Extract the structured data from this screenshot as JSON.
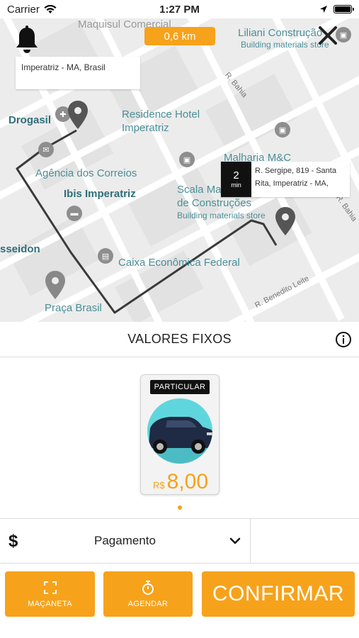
{
  "status_bar": {
    "carrier": "Carrier",
    "time": "1:27 PM"
  },
  "map": {
    "distance": "0,6 km",
    "origin_address": "Imperatriz - MA, Brasil",
    "destination": {
      "eta_value": "2",
      "eta_unit": "min",
      "address": "R. Sergipe, 819 - Santa Rita, Imperatriz - MA,"
    },
    "labels": {
      "maquisul": "Maquisul Comercial",
      "liliani": "Liliani Construção",
      "building_materials_top": "Building materials store",
      "drogasil": "Drogasil",
      "residence_hotel": "Residence Hotel Imperatriz",
      "malharia": "Malharia M&C",
      "agencia": "Agência dos Correios",
      "ibis": "Ibis Imperatriz",
      "scala": "Scala Materiais de Construções",
      "building_materials_mid": "Building materials store",
      "posseidon": "sseidon",
      "caixa": "Caixa Econômica Federal",
      "praca": "Praça Brasil",
      "rua_bahia_top": "R. Bahia",
      "rua_bahia_right": "R. Bahia",
      "rua_benedito": "R. Benedito Leite"
    },
    "colors": {
      "accent": "#f7a21b",
      "route": "#333333"
    }
  },
  "section": {
    "title": "VALORES FIXOS"
  },
  "vehicle": {
    "badge": "PARTICULAR",
    "currency": "R$",
    "price": "8,00"
  },
  "payment": {
    "icon": "$",
    "label": "Pagamento"
  },
  "actions": {
    "manaceta": "MAÇANETA",
    "agendar": "AGENDAR",
    "confirmar": "CONFIRMAR"
  },
  "icons": [
    "bell-icon",
    "close-icon",
    "info-icon",
    "chevron-down-icon",
    "expand-icon",
    "stopwatch-icon",
    "wifi-icon",
    "location-arrow-icon",
    "battery-icon"
  ]
}
